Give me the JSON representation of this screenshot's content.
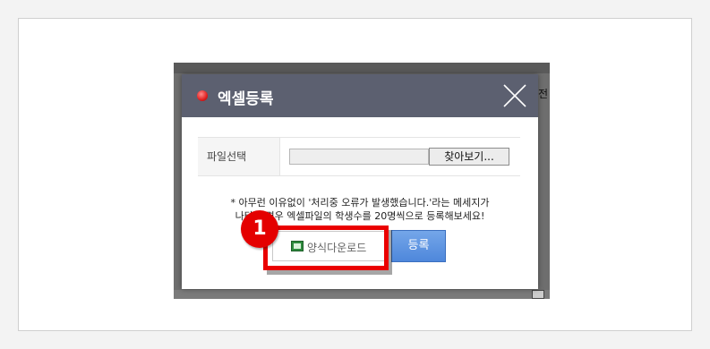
{
  "modal": {
    "title": "엑셀등록",
    "file_label": "파일선택",
    "browse_button": "찾아보기...",
    "file_value": "",
    "notice_line1": "* 아무런 이유없이 '처리중 오류가 발생했습니다.'라는 메세지가",
    "notice_line2": "나타날 경우 엑셀파일의 학생수를 20명씩으로 등록해보세요!",
    "template_button": "양식다운로드",
    "register_button": "등록"
  },
  "annotation": {
    "step_number": "1",
    "highlight_color": "#ea0000"
  },
  "background": {
    "right_partial_text": "전"
  }
}
